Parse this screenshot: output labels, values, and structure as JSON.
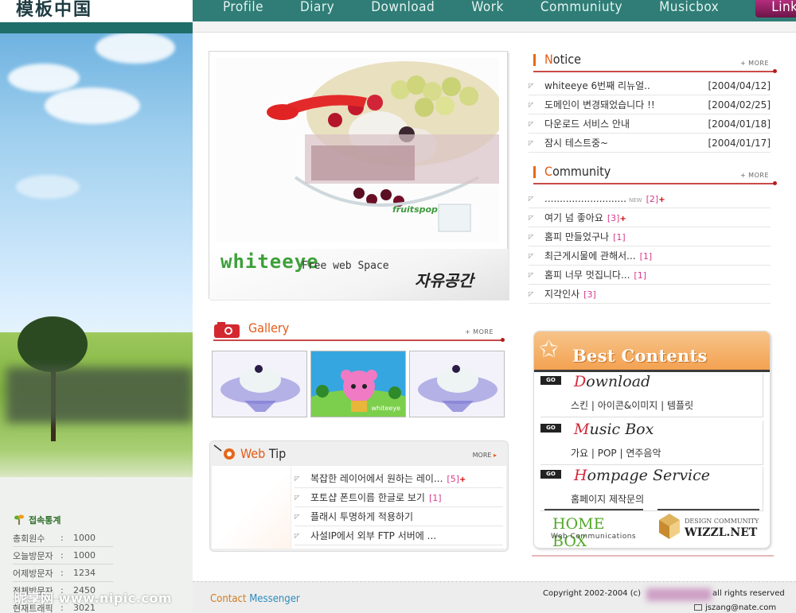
{
  "site": {
    "logo_text": "模板中国"
  },
  "nav": {
    "items": [
      "Profile",
      "Diary",
      "Download",
      "Work",
      "Communiuty",
      "Musicbox"
    ],
    "active": "Link"
  },
  "hero": {
    "brand": "whiteeye",
    "subtitle": "Free web Space",
    "script_text": "자유공간",
    "watermark_logo": "fruitspop"
  },
  "notice": {
    "title_first": "N",
    "title_rest": "otice",
    "more": "+ MORE",
    "items": [
      {
        "text": "whiteeye 6번째 리뉴얼..",
        "date": "[2004/04/12]"
      },
      {
        "text": "도메인이 변경돼었습니다 !!",
        "date": "[2004/02/25]"
      },
      {
        "text": "다운로드 서비스 안내",
        "date": "[2004/01/18]"
      },
      {
        "text": "잠시 테스트중~",
        "date": "[2004/01/17]"
      }
    ]
  },
  "community": {
    "title_first": "C",
    "title_rest": "ommunity",
    "more": "+ MORE",
    "items": [
      {
        "text": "...........................",
        "tag": "NEW",
        "count": "[2]",
        "new": true
      },
      {
        "text": "여기 넘 좋아요",
        "count": "[3]",
        "new": true
      },
      {
        "text": "홈피 만들었구나",
        "count": "[1]",
        "new": false
      },
      {
        "text": "최근게시물에 관해서...",
        "count": "[1]",
        "new": false
      },
      {
        "text": "홈피 너무 멋집니다...",
        "count": "[1]",
        "new": false
      },
      {
        "text": "지각인사",
        "count": "[3]",
        "new": false
      }
    ]
  },
  "gallery": {
    "title_first": "G",
    "title_rest": "allery",
    "more": "+ MORE",
    "thumb_caption": "whiteeye"
  },
  "webtip": {
    "title_first": "Web",
    "title_rest": " Tip",
    "more": "MORE",
    "items": [
      {
        "text": "복잡한 레이어에서 원하는 레이...",
        "count": "[5]",
        "new": true
      },
      {
        "text": "포토샵 폰트이름 한글로 보기",
        "count": "[1]",
        "new": false
      },
      {
        "text": "플래시 투명하게 적용하기",
        "count": "",
        "new": false
      },
      {
        "text": "사설IP에서 외부 FTP 서버에 ...",
        "count": "",
        "new": false
      }
    ]
  },
  "best": {
    "title": "Best Contents",
    "go": "GO",
    "items": [
      {
        "first": "D",
        "rest": "ownload",
        "desc": "스킨 | 아이콘&이미지 | 템플릿"
      },
      {
        "first": "M",
        "rest": "usic Box",
        "desc": "가요 | POP | 연주음악"
      },
      {
        "first": "H",
        "rest": "ompage Service",
        "desc": "홈페이지 제작문의"
      }
    ],
    "logos": {
      "homebox_title": "HOME BOX",
      "homebox_sub": "Web Communications",
      "wizzl_top": "DESIGN COMMUNITY",
      "wizzl_name": "WIZZL.NET"
    }
  },
  "stats": {
    "title": "접속통계",
    "rows": [
      {
        "label": "총회원수",
        "value": "1000"
      },
      {
        "label": "오늘방문자",
        "value": "1000"
      },
      {
        "label": "어제방문자",
        "value": "1234"
      },
      {
        "label": "전체방문자",
        "value": "2450"
      },
      {
        "label": "현재트래픽",
        "value": "3021"
      }
    ]
  },
  "footer": {
    "contact_c": "Contact",
    "contact_m": "Messenger",
    "copyright": "Copyright 2002-2004 (c)",
    "copyright_end": "all rights reserved",
    "email": "jszang@nate.com"
  },
  "watermark": "昵享网 www.nipic.com",
  "colors": {
    "nav_bg": "#2f7d76",
    "accent_orange": "#e35a16",
    "count_pink": "#d63a8c",
    "best_head": "#f3a251",
    "active_nav": "#b32d7d"
  }
}
